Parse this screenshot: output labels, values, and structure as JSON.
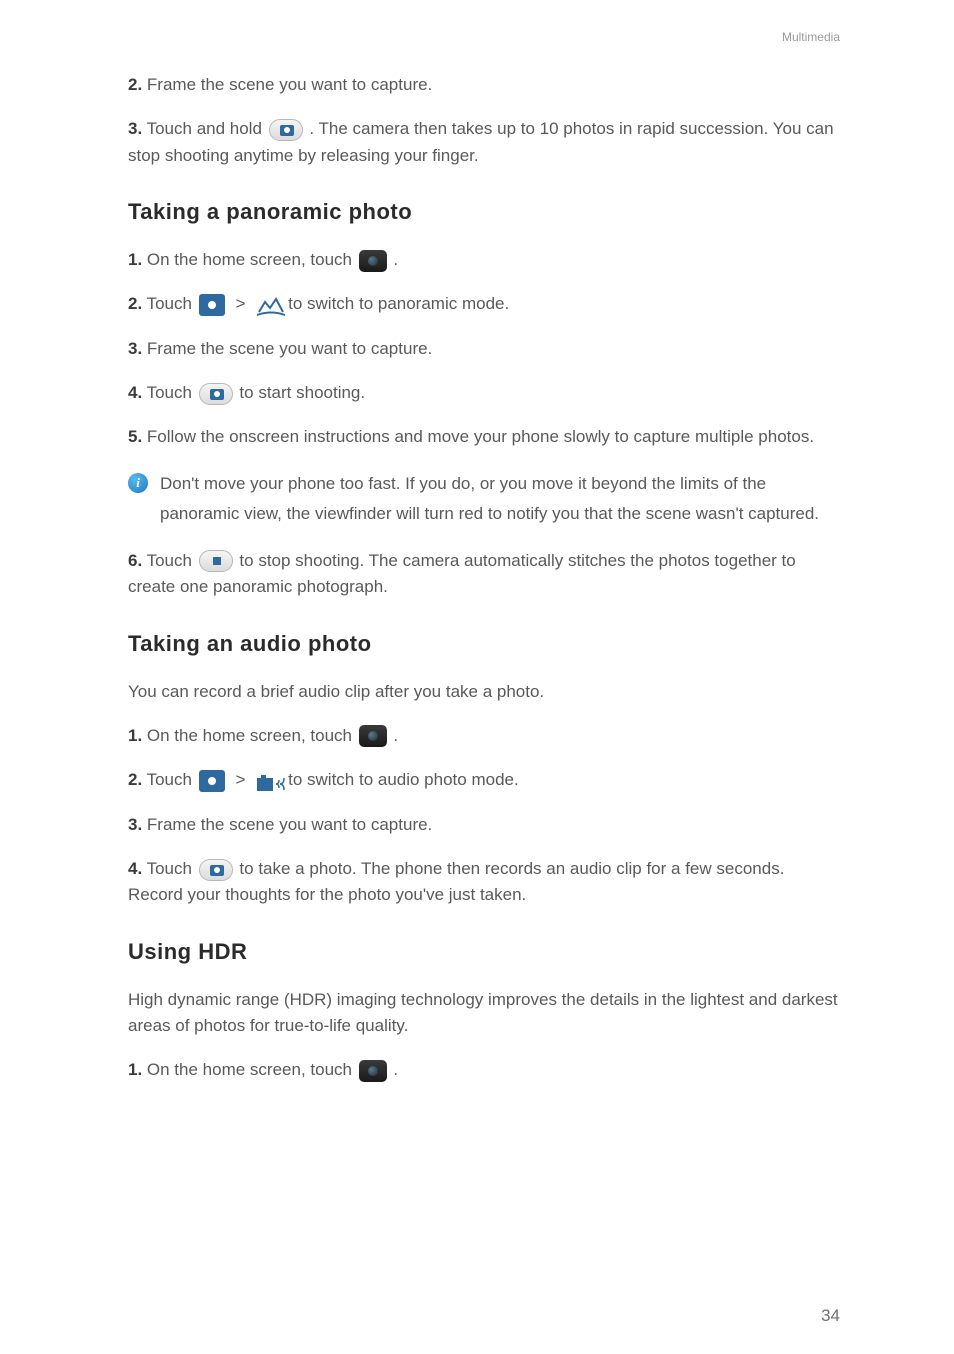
{
  "header": {
    "section": "Multimedia"
  },
  "burst": {
    "step2_num": "2.",
    "step2_text": " Frame the scene you want to capture.",
    "step3_num": "3.",
    "step3_a": " Touch and hold ",
    "step3_b": " . The camera then takes up to 10 photos in rapid succession. You can stop shooting anytime by releasing your finger."
  },
  "pano": {
    "heading": "Taking a panoramic photo",
    "step1_num": "1.",
    "step1_a": " On the home screen, touch ",
    "step1_b": " .",
    "step2_num": "2.",
    "step2_a": " Touch ",
    "step2_b": "to switch to panoramic mode.",
    "step3_num": "3.",
    "step3_text": " Frame the scene you want to capture.",
    "step4_num": "4.",
    "step4_a": " Touch ",
    "step4_b": " to start shooting.",
    "step5_num": "5.",
    "step5_text": " Follow the onscreen instructions and move your phone slowly to capture multiple photos.",
    "info": "Don't move your phone too fast. If you do, or you move it beyond the limits of the panoramic view, the viewfinder will turn red to notify you that the scene wasn't captured.",
    "step6_num": "6.",
    "step6_a": " Touch ",
    "step6_b": " to stop shooting. The camera automatically stitches the photos together to create one panoramic photograph."
  },
  "audio": {
    "heading": "Taking an audio photo",
    "intro": "You can record a brief audio clip after you take a photo.",
    "step1_num": "1.",
    "step1_a": " On the home screen, touch ",
    "step1_b": " .",
    "step2_num": "2.",
    "step2_a": " Touch ",
    "step2_b": "to switch to audio photo mode.",
    "step3_num": "3.",
    "step3_text": " Frame the scene you want to capture.",
    "step4_num": "4.",
    "step4_a": " Touch ",
    "step4_b": " to take a photo. The phone then records an audio clip for a few seconds. Record your thoughts for the photo you've just taken."
  },
  "hdr": {
    "heading": "Using HDR",
    "intro": "High dynamic range (HDR) imaging technology improves the details in the lightest and darkest areas of photos for true-to-life quality.",
    "step1_num": "1.",
    "step1_a": " On the home screen, touch ",
    "step1_b": " ."
  },
  "gt": ">",
  "pagenum": "34"
}
